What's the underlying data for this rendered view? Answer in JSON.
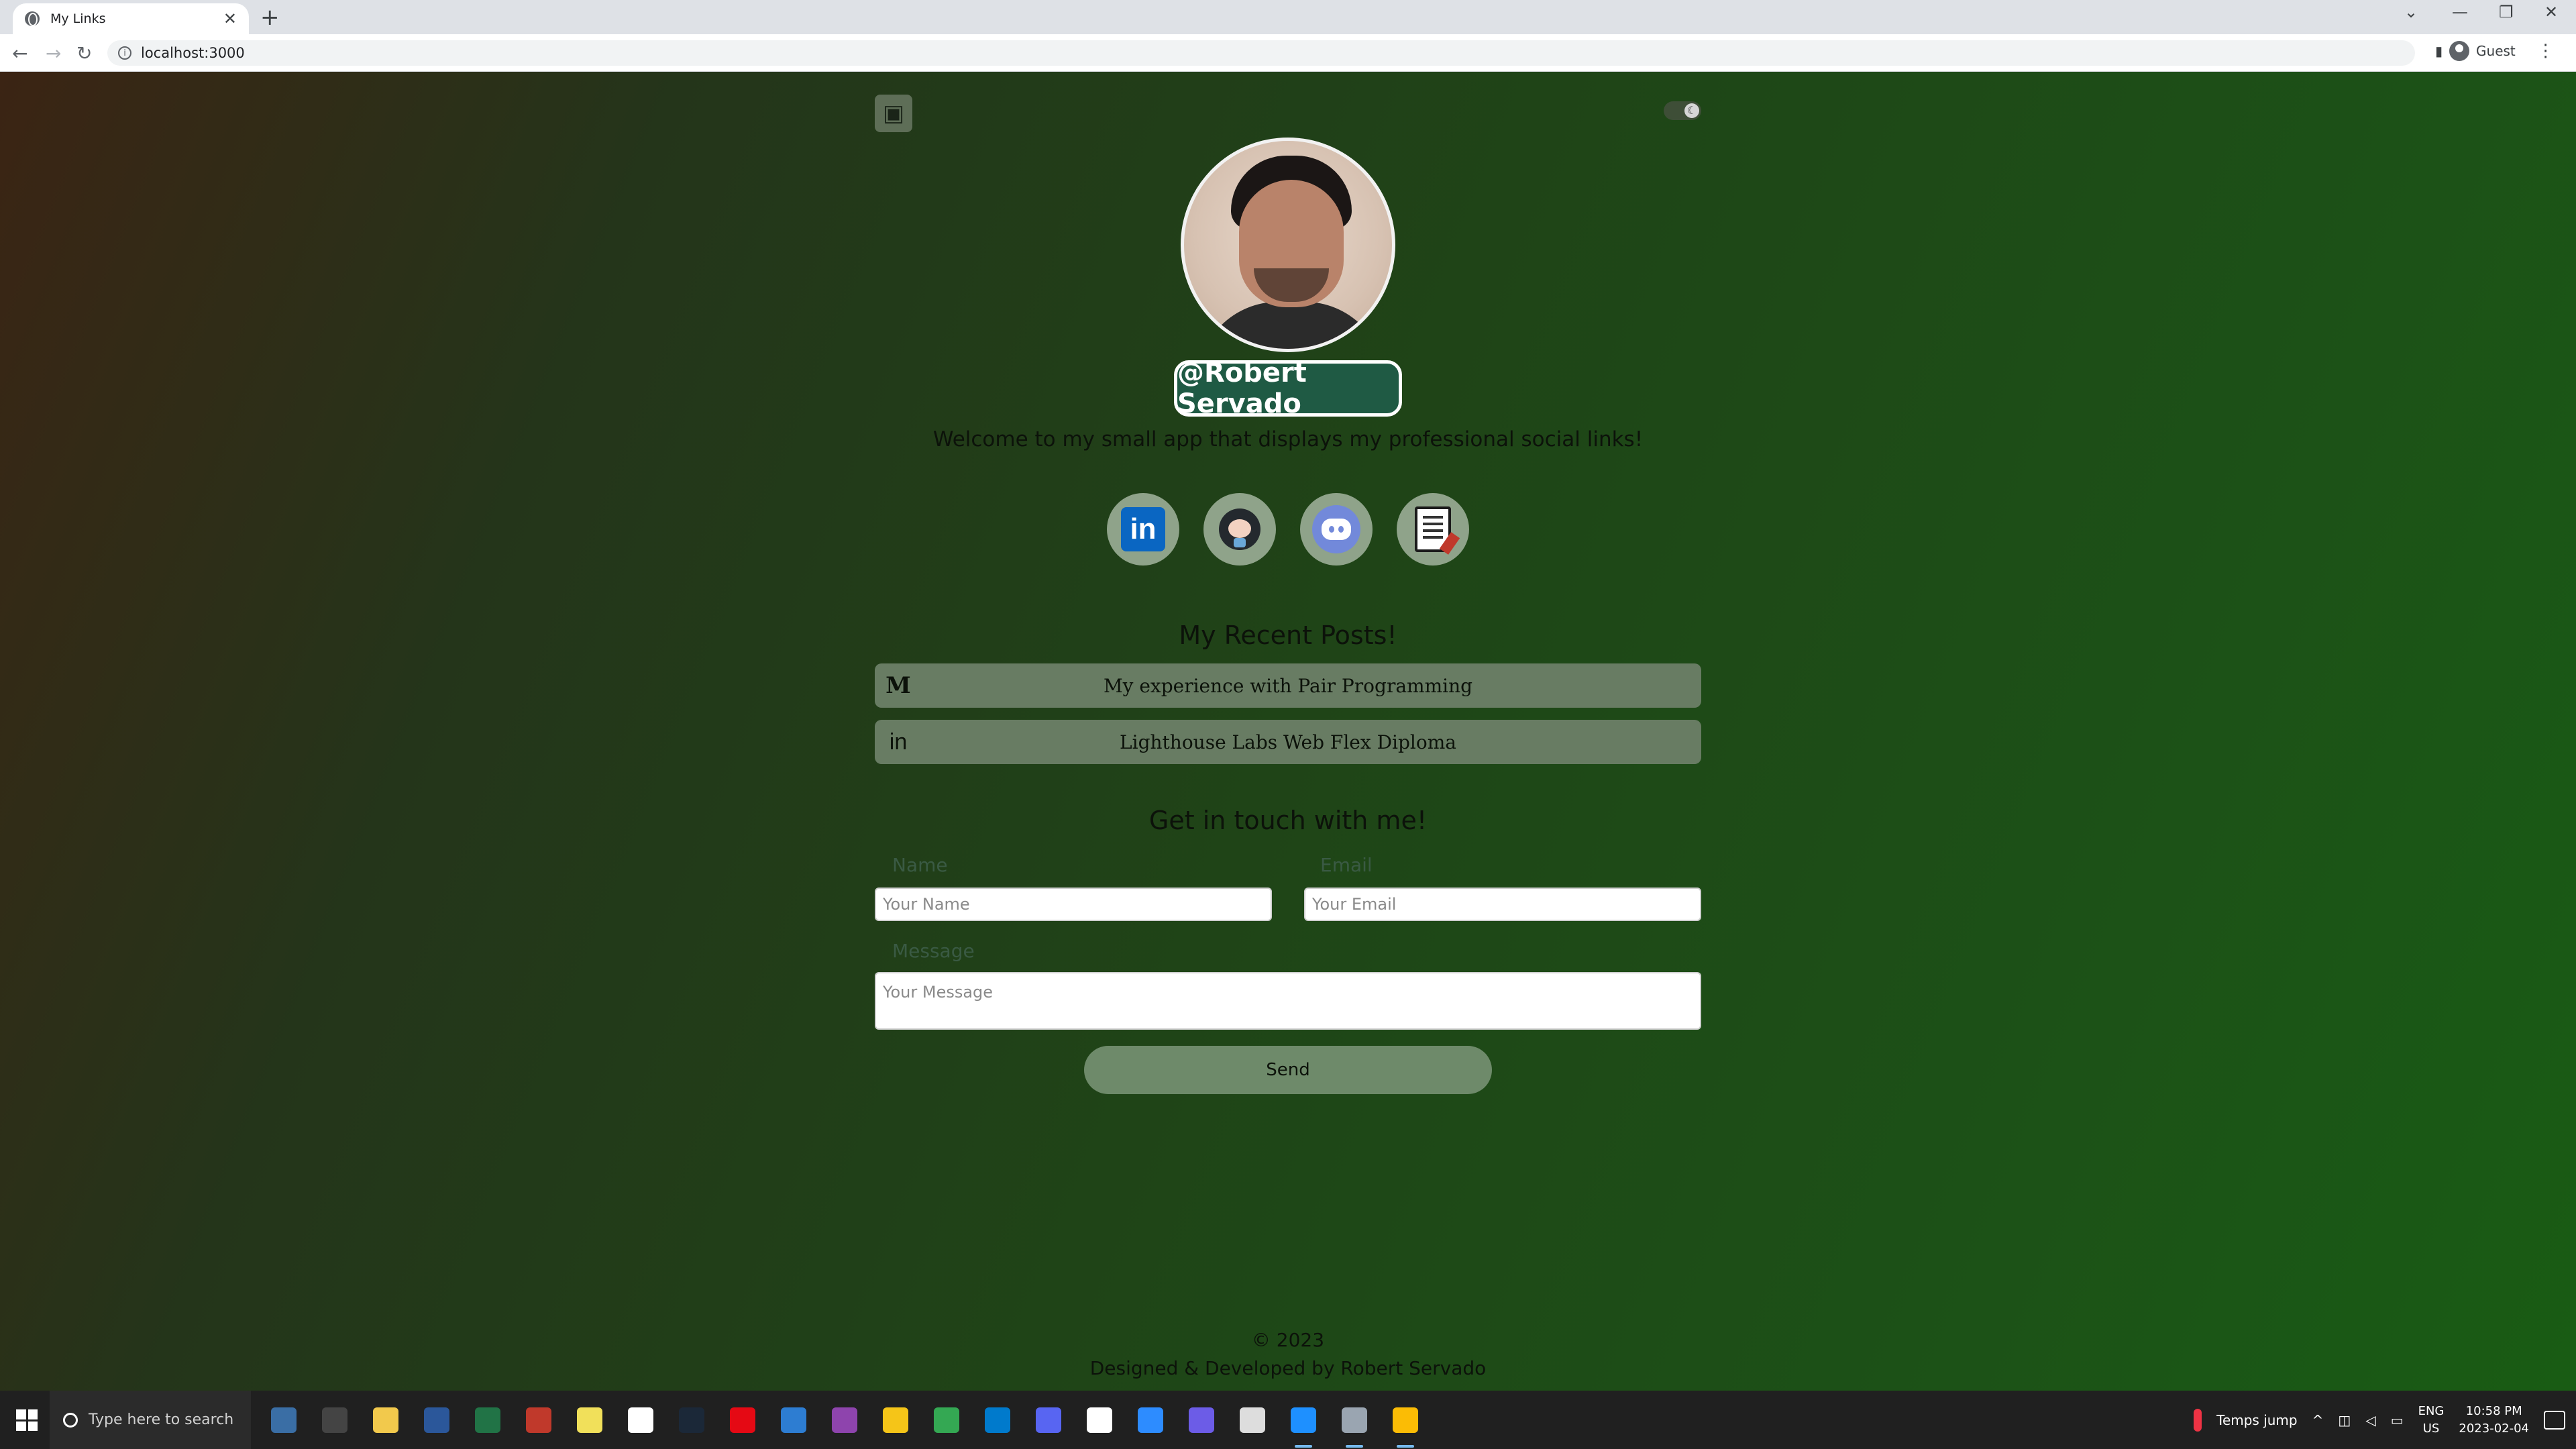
{
  "browser": {
    "tab_title": "My Links",
    "tab_close": "✕",
    "new_tab": "+",
    "url": "localhost:3000",
    "profile_label": "Guest",
    "win_minimize": "—",
    "win_restore": "❐",
    "win_close": "✕",
    "tab_list": "⌄",
    "back": "←",
    "forward": "→",
    "reload": "↻",
    "menu": "⋮",
    "side_panel": "▮"
  },
  "page": {
    "handle": "@Robert Servado",
    "welcome": "Welcome to my small app that displays my professional social links!",
    "socials": [
      {
        "name": "linkedin",
        "glyph": "in"
      },
      {
        "name": "github"
      },
      {
        "name": "discord"
      },
      {
        "name": "resume"
      }
    ],
    "posts_title": "My Recent Posts!",
    "posts": [
      {
        "icon": "medium-icon",
        "glyph": "M",
        "title": "My experience with Pair Programming"
      },
      {
        "icon": "linkedin-icon",
        "glyph": "in",
        "title": "Lighthouse Labs Web Flex Diploma"
      }
    ],
    "contact": {
      "title": "Get in touch with me!",
      "name_label": "Name",
      "name_placeholder": "Your Name",
      "email_label": "Email",
      "email_placeholder": "Your Email",
      "message_label": "Message",
      "message_placeholder": "Your Message",
      "send_label": "Send"
    },
    "footer": {
      "copyright": "© 2023",
      "credit": "Designed & Developed by Robert Servado"
    }
  },
  "taskbar": {
    "search_placeholder": "Type here to search",
    "weather": "Temps jump",
    "lang_top": "ENG",
    "lang_bottom": "US",
    "time": "10:58 PM",
    "date": "2023-02-04",
    "apps": [
      {
        "name": "widgets",
        "color": "#3a6ea5"
      },
      {
        "name": "task-view",
        "color": "#444444"
      },
      {
        "name": "file-explorer",
        "color": "#f2c94c"
      },
      {
        "name": "word",
        "color": "#2b579a"
      },
      {
        "name": "excel",
        "color": "#217346"
      },
      {
        "name": "app-red",
        "color": "#c0392b"
      },
      {
        "name": "notes",
        "color": "#f1e05a"
      },
      {
        "name": "file",
        "color": "#ffffff"
      },
      {
        "name": "steam",
        "color": "#1b2838"
      },
      {
        "name": "netflix",
        "color": "#e50914"
      },
      {
        "name": "app-blue",
        "color": "#2d7dd2"
      },
      {
        "name": "app-purple",
        "color": "#8e44ad"
      },
      {
        "name": "linux",
        "color": "#f5c518"
      },
      {
        "name": "chrome",
        "color": "#34a853"
      },
      {
        "name": "vscode",
        "color": "#007acc"
      },
      {
        "name": "discord",
        "color": "#5865f2"
      },
      {
        "name": "slack",
        "color": "#ffffff"
      },
      {
        "name": "zoom",
        "color": "#2d8cff"
      },
      {
        "name": "app-violet",
        "color": "#6c5ce7"
      },
      {
        "name": "github-desktop",
        "color": "#dddddd"
      },
      {
        "name": "app-globe",
        "color": "#1e90ff"
      },
      {
        "name": "app-tool",
        "color": "#9aa5b1"
      },
      {
        "name": "chrome-active",
        "color": "#fbbc05"
      }
    ]
  }
}
